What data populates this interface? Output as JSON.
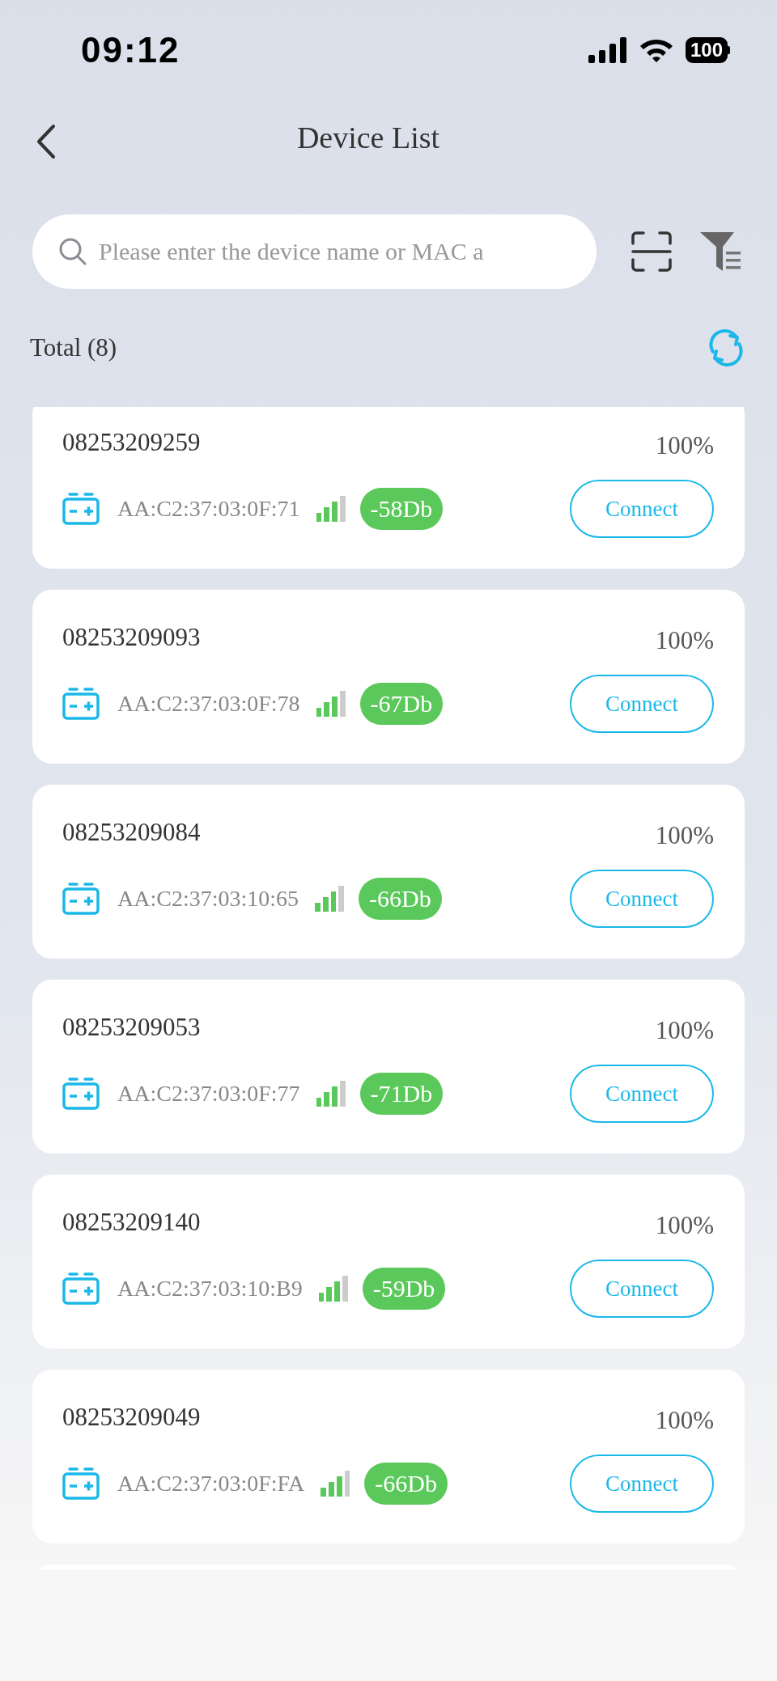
{
  "status_bar": {
    "time": "09:12",
    "battery": "100"
  },
  "header": {
    "title": "Device List"
  },
  "search": {
    "placeholder": "Please enter the device name or MAC a"
  },
  "total": "Total (8)",
  "devices": [
    {
      "name": "08253209259",
      "battery": "100%",
      "mac": "AA:C2:37:03:0F:71",
      "level": 0.75,
      "rssi": "-58Db",
      "action": "Connect"
    },
    {
      "name": "08253209093",
      "battery": "100%",
      "mac": "AA:C2:37:03:0F:78",
      "level": 0.75,
      "rssi": "-67Db",
      "action": "Connect"
    },
    {
      "name": "08253209084",
      "battery": "100%",
      "mac": "AA:C2:37:03:10:65",
      "level": 0.75,
      "rssi": "-66Db",
      "action": "Connect"
    },
    {
      "name": "08253209053",
      "battery": "100%",
      "mac": "AA:C2:37:03:0F:77",
      "level": 0.75,
      "rssi": "-71Db",
      "action": "Connect"
    },
    {
      "name": "08253209140",
      "battery": "100%",
      "mac": "AA:C2:37:03:10:B9",
      "level": 0.75,
      "rssi": "-59Db",
      "action": "Connect"
    },
    {
      "name": "08253209049",
      "battery": "100%",
      "mac": "AA:C2:37:03:0F:FA",
      "level": 0.75,
      "rssi": "-66Db",
      "action": "Connect"
    }
  ]
}
